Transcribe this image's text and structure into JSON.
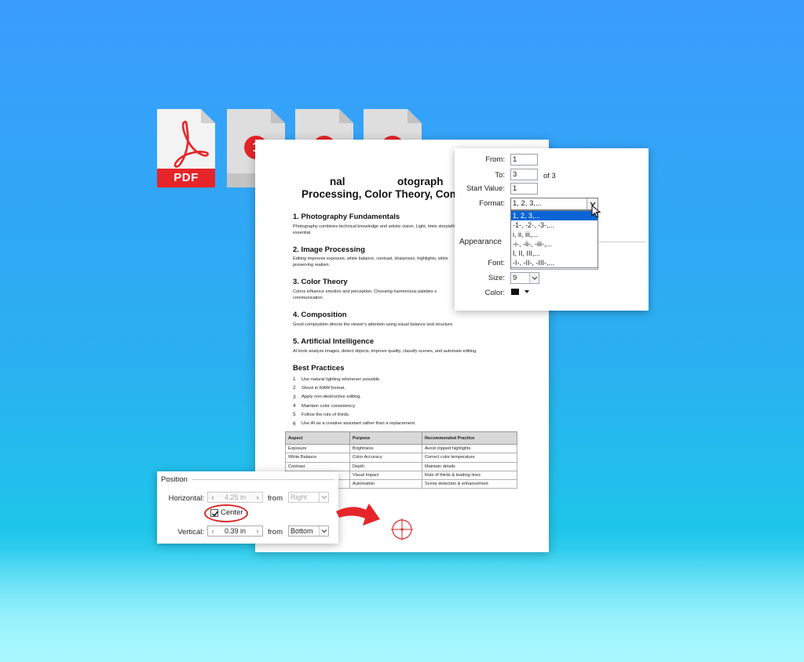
{
  "files": {
    "pdf_label": "PDF",
    "pages": [
      "1",
      "2",
      "3"
    ]
  },
  "colors": {
    "accent_red": "#e5252a",
    "selection_blue": "#0a64d6",
    "bg_blue": "#3a9cfd"
  },
  "document": {
    "title_line1": "nal",
    "title_line1b": "otograph",
    "title_line2": "Processing, Color Theory, Composit",
    "sections": [
      {
        "title": "1. Photography Fundamentals",
        "text": "Photography combines technical knowledge and artistic vision. Light, timin storytelling are essential."
      },
      {
        "title": "2. Image Processing",
        "text": "Editing improves exposure, white balance, contrast, sharpness, highlights, while preserving realism."
      },
      {
        "title": "3. Color Theory",
        "text": "Colors influence emotion and perception. Choosing harmonious palettes s communication."
      },
      {
        "title": "4. Composition",
        "text": "Good composition directs the viewer's attention using visual balance and structure."
      },
      {
        "title": "5. Artificial Intelligence",
        "text": "AI tools analyze images, detect objects, improve quality, classify scenes, and automate editing."
      }
    ],
    "best_practices": {
      "title": "Best Practices",
      "items": [
        {
          "num": "1",
          "text": "Use natural lighting whenever possible."
        },
        {
          "num": "2",
          "text": "Shoot in RAW format."
        },
        {
          "num": "3",
          "text": "Apply non-destructive editing."
        },
        {
          "num": "4",
          "text": "Maintain color consistency."
        },
        {
          "num": "5",
          "text": "Follow the rule of thirds."
        },
        {
          "num": "6",
          "text": "Use AI as a creative assistant rather than a replacement."
        }
      ]
    },
    "table": {
      "headers": [
        "Aspect",
        "Purpose",
        "Recommended Practice"
      ],
      "rows": [
        [
          "Exposure",
          "Brightness",
          "Avoid clipped highlights"
        ],
        [
          "White Balance",
          "Color Accuracy",
          "Correct color temperature"
        ],
        [
          "Contrast",
          "Depth",
          "Maintain details"
        ],
        [
          "",
          "Visual Impact",
          "Rule of thirds & leading lines"
        ],
        [
          "",
          "Automation",
          "Scene detection & enhancement"
        ]
      ]
    }
  },
  "numbering": {
    "from_label": "From:",
    "from_value": "1",
    "to_label": "To:",
    "to_value": "3",
    "of_text": "of 3",
    "start_label": "Start Value:",
    "start_value": "1",
    "format_label": "Format:",
    "format_value": "1, 2, 3,...",
    "format_options": [
      "1, 2, 3,...",
      "-1-, -2-, -3-,...",
      "i, ii, iii,...",
      "-i-, -ii-, -iii-,...",
      "I, II, III,...",
      "-I-, -II-, -III-,..."
    ],
    "appearance_title": "Appearance",
    "font_label": "Font:",
    "size_label": "Size:",
    "size_value": "9",
    "color_label": "Color:"
  },
  "position": {
    "title": "Position",
    "horizontal_label": "Horizontal:",
    "horizontal_value": "4.25 in",
    "from_label": "from",
    "horizontal_from": "Right",
    "center_label": "Center",
    "center_checked": true,
    "vertical_label": "Vertical:",
    "vertical_value": "0.39 in",
    "vertical_from": "Bottom"
  }
}
